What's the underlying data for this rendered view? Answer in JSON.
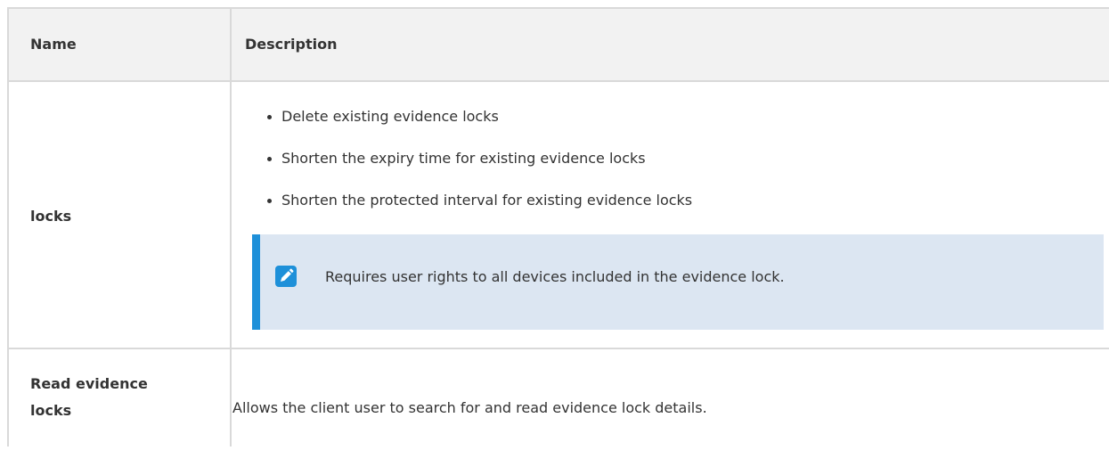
{
  "table": {
    "headers": {
      "name": "Name",
      "description": "Description"
    },
    "rows": [
      {
        "name": "locks",
        "bullets": [
          "Delete existing evidence locks",
          "Shorten the expiry time for existing evidence locks",
          "Shorten the protected interval for existing evidence locks"
        ],
        "note": {
          "icon": "pencil-icon",
          "text": "Requires user rights to all devices included in the evidence lock."
        }
      },
      {
        "name_line1": "Read evidence",
        "name_line2": "locks",
        "description": "Allows the client user to search for and read evidence lock details."
      }
    ]
  },
  "colors": {
    "note_accent": "#1e90d9",
    "note_background": "#dce6f2",
    "header_background": "#f2f2f2"
  }
}
